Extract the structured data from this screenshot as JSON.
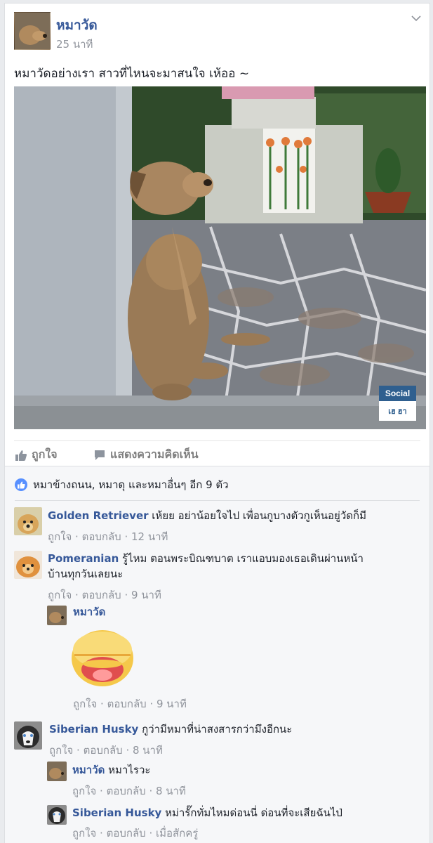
{
  "post": {
    "author": "หมาวัด",
    "time": "25 นาที",
    "text": "หมาวัดอย่างเรา สาวที่ไหนจะมาสนใจ เห้ออ ~",
    "badge_top": "Social",
    "badge_bottom": "เฮ ฮา",
    "like_label": "ถูกใจ",
    "comment_label": "แสดงความคิดเห็น"
  },
  "likes": {
    "summary": "หมาข้างถนน, หมาดุ และหมาอื่นๆ อีก 9 ตัว"
  },
  "comments": [
    {
      "name": "Golden Retriever",
      "text": " เห้ยย อย่าน้อยใจไป เพื่อนกูบางตัวกูเห็นอยู่วัดก็มี",
      "like": "ถูกใจ",
      "reply": "ตอบกลับ",
      "time": "12 นาที"
    },
    {
      "name": "Pomeranian",
      "text": " รู้ไหม ตอนพระบิณฑบาต เราแอบมองเธอเดินผ่านหน้า",
      "text2": "บ้านทุกวันเลยนะ",
      "like": "ถูกใจ",
      "reply": "ตอบกลับ",
      "time": "9 นาที"
    },
    {
      "name": "หมาวัด",
      "text": "",
      "like": "ถูกใจ",
      "reply": "ตอบกลับ",
      "time": "9 นาที"
    },
    {
      "name": "Siberian Husky",
      "text": " กูว่ามีหมาที่น่าสงสารกว่ามึงอีกนะ",
      "like": "ถูกใจ",
      "reply": "ตอบกลับ",
      "time": "8 นาที"
    },
    {
      "name": "หมาวัด",
      "text": " หมาไรวะ",
      "like": "ถูกใจ",
      "reply": "ตอบกลับ",
      "time": "8 นาที"
    },
    {
      "name": "Siberian Husky",
      "text": " หม่ารั๊กทั่มไหมด่อนนี่ ด่อนที่จะเสียฉันไป่",
      "like": "ถูกใจ",
      "reply": "ตอบกลับ",
      "time": "เมื่อสักครู่"
    }
  ],
  "meta_sep": " · ",
  "colors": {
    "link": "#365899",
    "meta": "#90949c",
    "like_blue": "#5890ff",
    "bg": "#e9ebee"
  }
}
